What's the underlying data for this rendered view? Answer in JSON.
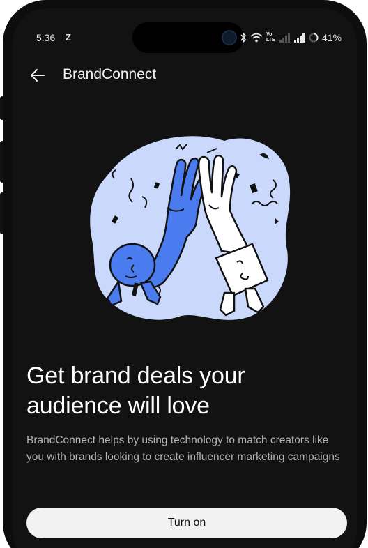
{
  "status_bar": {
    "time": "5:36",
    "notification_letter": "Z",
    "volte_label": "Vo LTE",
    "battery_percent": "41%",
    "icons": [
      "bluetooth-icon",
      "wifi-icon",
      "volte-icon",
      "signal-weak-icon",
      "signal-icon",
      "battery-ring-icon"
    ]
  },
  "app_bar": {
    "title": "BrandConnect",
    "back_icon": "arrow-back-icon"
  },
  "illustration": {
    "name": "high-five-illustration",
    "colors": {
      "blob": "#c9d8fb",
      "blue_hand": "#4a7cf0",
      "white_hand": "#ffffff",
      "outline": "#111111"
    }
  },
  "content": {
    "headline": "Get brand deals your audience will love",
    "description": "BrandConnect helps by using technology to match creators like you with brands looking to create influencer marketing campaigns"
  },
  "actions": {
    "turn_on_label": "Turn on"
  }
}
